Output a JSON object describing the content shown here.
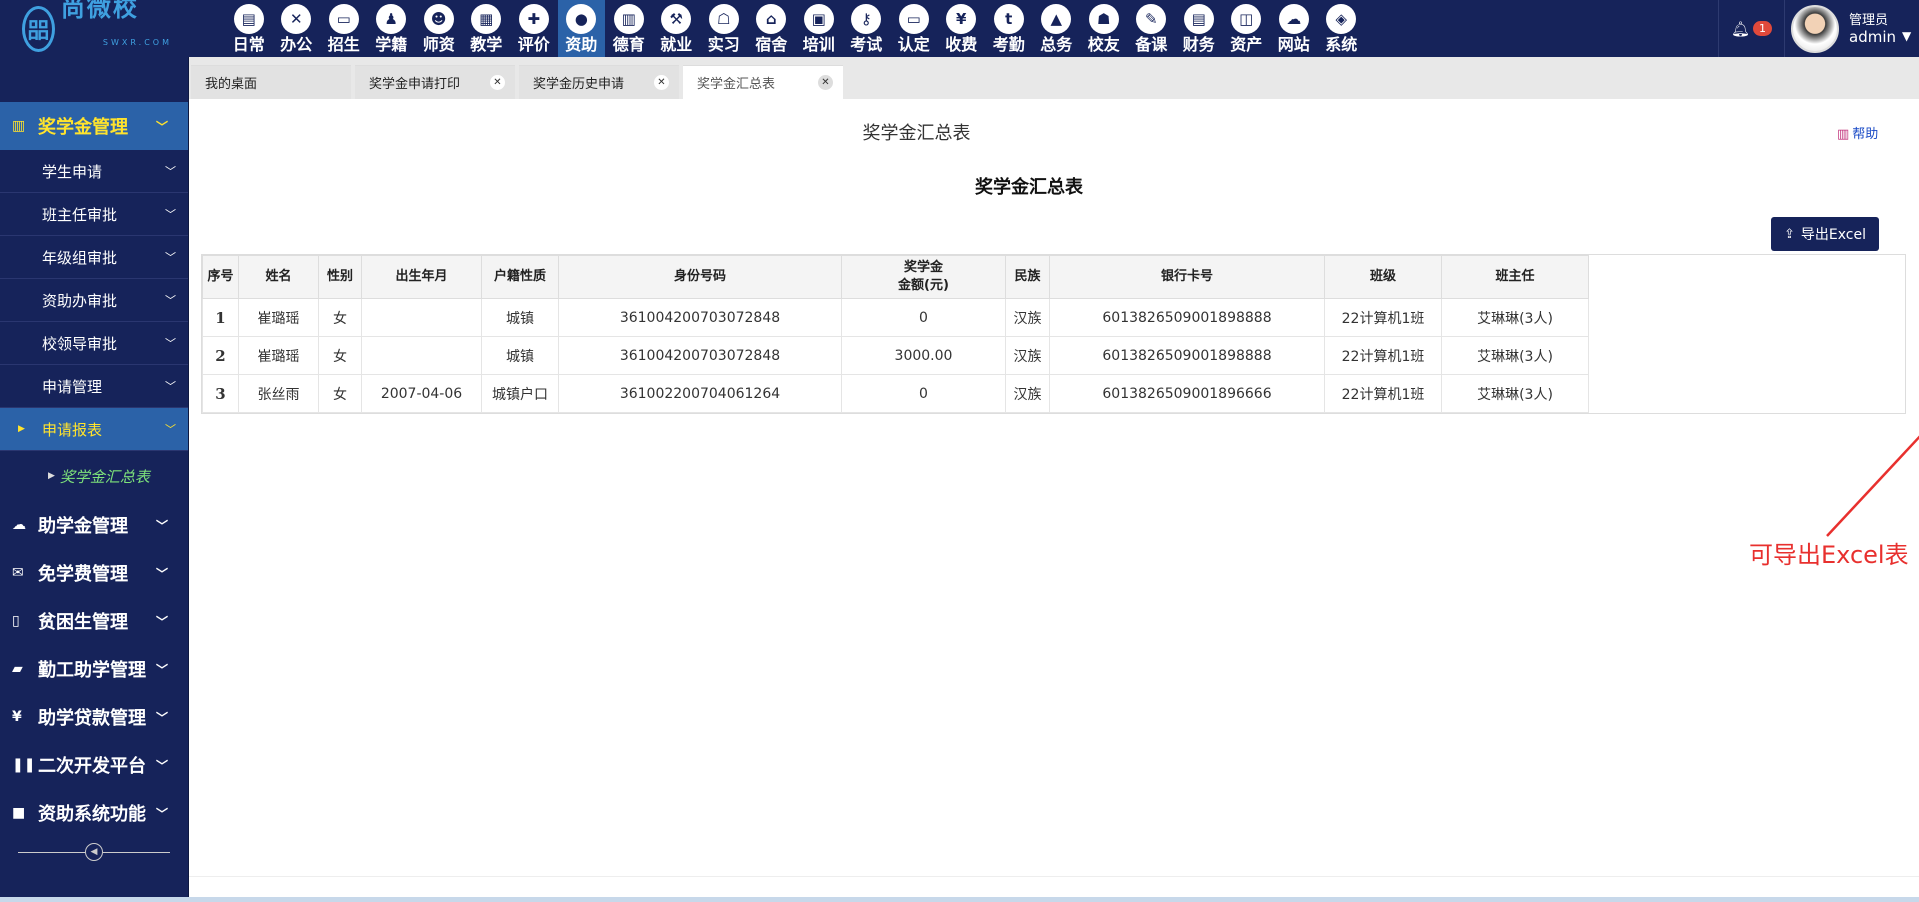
{
  "logo": {
    "mark": "㗊",
    "name": "尚微校",
    "sub": "SWXR.COM"
  },
  "nav": [
    {
      "label": "日常",
      "icon": "doc-icon",
      "glyph": "▤"
    },
    {
      "label": "办公",
      "icon": "office-icon",
      "glyph": "✕"
    },
    {
      "label": "招生",
      "icon": "bus-icon",
      "glyph": "▭"
    },
    {
      "label": "学籍",
      "icon": "person-icon",
      "glyph": "♟"
    },
    {
      "label": "师资",
      "icon": "teacher-icon",
      "glyph": "☻"
    },
    {
      "label": "教学",
      "icon": "calendar-icon",
      "glyph": "▦"
    },
    {
      "label": "评价",
      "icon": "calendar-plus-icon",
      "glyph": "✚"
    },
    {
      "label": "资助",
      "icon": "funding-icon",
      "glyph": "●",
      "active": true
    },
    {
      "label": "德育",
      "icon": "book-icon",
      "glyph": "▥"
    },
    {
      "label": "就业",
      "icon": "gavel-icon",
      "glyph": "⚒"
    },
    {
      "label": "实习",
      "icon": "robot-icon",
      "glyph": "☖"
    },
    {
      "label": "宿舍",
      "icon": "home-icon",
      "glyph": "⌂"
    },
    {
      "label": "培训",
      "icon": "image-icon",
      "glyph": "▣"
    },
    {
      "label": "考试",
      "icon": "key-icon",
      "glyph": "⚷"
    },
    {
      "label": "认定",
      "icon": "monitor-icon",
      "glyph": "▭"
    },
    {
      "label": "收费",
      "icon": "yen-icon",
      "glyph": "¥"
    },
    {
      "label": "考勤",
      "icon": "t-icon",
      "glyph": "t"
    },
    {
      "label": "总务",
      "icon": "chart-icon",
      "glyph": "▲"
    },
    {
      "label": "校友",
      "icon": "group-icon",
      "glyph": "☗"
    },
    {
      "label": "备课",
      "icon": "edit-icon",
      "glyph": "✎"
    },
    {
      "label": "财务",
      "icon": "news-icon",
      "glyph": "▤"
    },
    {
      "label": "资产",
      "icon": "train-icon",
      "glyph": "◫"
    },
    {
      "label": "网站",
      "icon": "cloud-icon",
      "glyph": "☁"
    },
    {
      "label": "系统",
      "icon": "cube-icon",
      "glyph": "◈"
    }
  ],
  "notifications": {
    "count": "1"
  },
  "user": {
    "role": "管理员",
    "name": "admin"
  },
  "sidebar": {
    "groups": [
      {
        "label": "奖学金管理",
        "icon": "book-icon",
        "glyph": "▥",
        "active": true
      },
      {
        "label": "助学金管理",
        "icon": "cloud-icon",
        "glyph": "☁"
      },
      {
        "label": "免学费管理",
        "icon": "envelope-icon",
        "glyph": "✉"
      },
      {
        "label": "贫困生管理",
        "icon": "file-icon",
        "glyph": "▯"
      },
      {
        "label": "勤工助学管理",
        "icon": "folder-icon",
        "glyph": "▰"
      },
      {
        "label": "助学贷款管理",
        "icon": "yen-box-icon",
        "glyph": "¥"
      },
      {
        "label": "二次开发平台",
        "icon": "columns-icon",
        "glyph": "❚❚"
      },
      {
        "label": "资助系统功能",
        "icon": "square-icon",
        "glyph": "■"
      }
    ],
    "subitems": [
      {
        "label": "学生申请"
      },
      {
        "label": "班主任审批"
      },
      {
        "label": "年级组审批"
      },
      {
        "label": "资助办审批"
      },
      {
        "label": "校领导审批"
      },
      {
        "label": "申请管理"
      },
      {
        "label": "申请报表",
        "active": true
      }
    ],
    "leaf": {
      "label": "奖学金汇总表"
    }
  },
  "tabs": [
    {
      "label": "我的桌面",
      "closable": false
    },
    {
      "label": "奖学金申请打印",
      "closable": true
    },
    {
      "label": "奖学金历史申请",
      "closable": true
    },
    {
      "label": "奖学金汇总表",
      "closable": true,
      "active": true
    }
  ],
  "page": {
    "title": "奖学金汇总表",
    "help": "帮助",
    "table_title": "奖学金汇总表",
    "export_label": "导出Excel",
    "annotation": "可导出Excel表"
  },
  "table": {
    "columns": [
      "序号",
      "姓名",
      "性别",
      "出生年月",
      "户籍性质",
      "身份号码",
      "奖学金\n金额(元)",
      "民族",
      "银行卡号",
      "班级",
      "班主任"
    ],
    "rows": [
      [
        "1",
        "崔璐瑶",
        "女",
        "",
        "城镇",
        "361004200703072848",
        "0",
        "汉族",
        "6013826509001898888",
        "22计算机1班",
        "艾琳琳(3人)"
      ],
      [
        "2",
        "崔璐瑶",
        "女",
        "",
        "城镇",
        "361004200703072848",
        "3000.00",
        "汉族",
        "6013826509001898888",
        "22计算机1班",
        "艾琳琳(3人)"
      ],
      [
        "3",
        "张丝雨",
        "女",
        "2007-04-06",
        "城镇户口",
        "361002200704061264",
        "0",
        "汉族",
        "6013826509001896666",
        "22计算机1班",
        "艾琳琳(3人)"
      ]
    ]
  }
}
